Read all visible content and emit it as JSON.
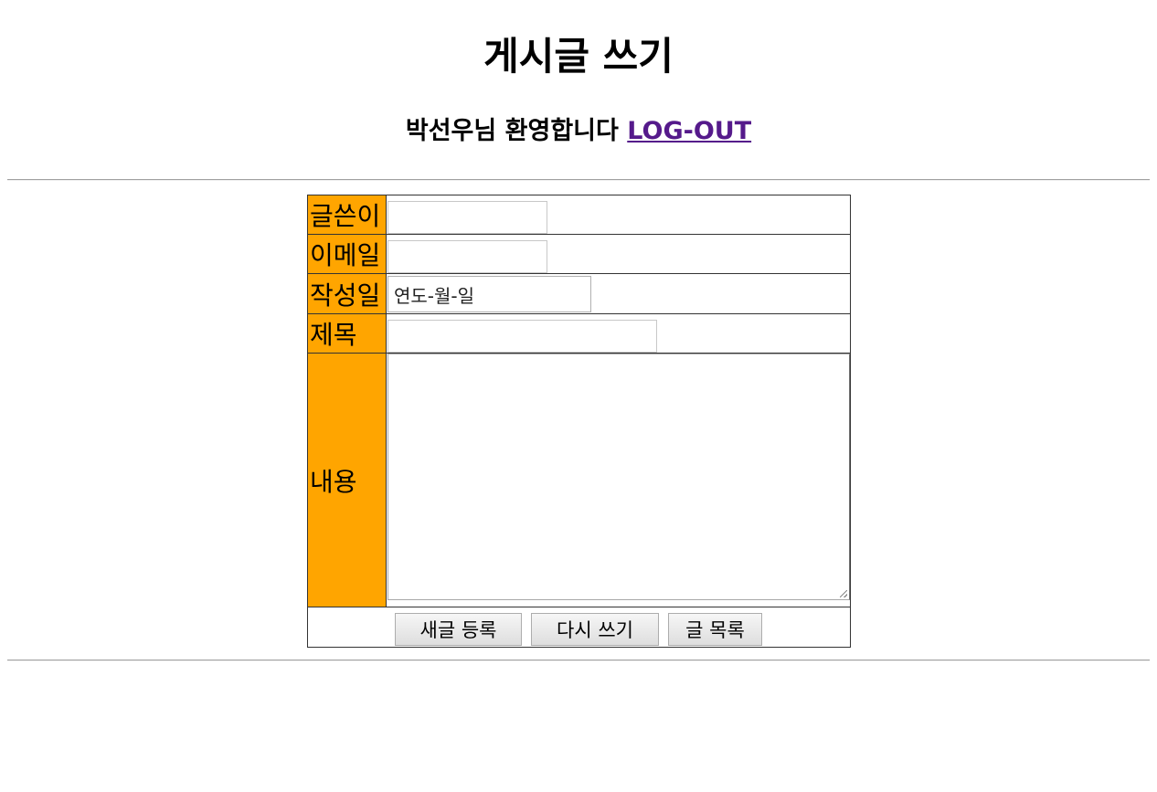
{
  "page": {
    "title": "게시글 쓰기",
    "welcome_text": "박선우님 환영합니다",
    "logout_link": "LOG-OUT"
  },
  "form": {
    "author_label": "글쓴이",
    "author_value": "",
    "email_label": "이메일",
    "email_value": "",
    "date_label": "작성일",
    "date_placeholder": "연도-월-일",
    "subject_label": "제목",
    "subject_value": "",
    "content_label": "내용",
    "content_value": ""
  },
  "buttons": {
    "submit": "새글 등록",
    "reset": "다시 쓰기",
    "list": "글 목록"
  },
  "colors": {
    "label_background": "#ffa500",
    "visited_link": "#551a8b"
  }
}
